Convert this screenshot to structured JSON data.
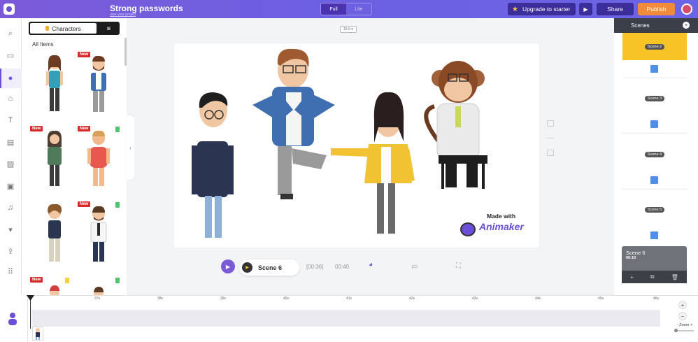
{
  "app": {
    "project_title": "Strong passwords",
    "project_subtitle": "user your project",
    "modes": [
      "Full",
      "Lite"
    ],
    "active_mode": "Full",
    "upgrade_label": "Upgrade to starter",
    "share_label": "Share",
    "publish_label": "Publish"
  },
  "left_rail": {
    "icons": [
      "search-icon",
      "folder-icon",
      "character-icon",
      "props-icon",
      "text-icon",
      "number-icon",
      "image-icon",
      "video-icon",
      "music-icon",
      "upload-bar-icon",
      "upload-icon",
      "apps-grid-icon"
    ],
    "active": "character-icon"
  },
  "library": {
    "tab_active": "Characters",
    "all_items_label": "All Items",
    "items": [
      {
        "name": "woman-teal",
        "badge": "",
        "flag": ""
      },
      {
        "name": "man-bearded-blue",
        "badge": "New",
        "flag": ""
      },
      {
        "name": "woman-camo",
        "badge": "New",
        "flag": ""
      },
      {
        "name": "man-red-tank",
        "badge": "New",
        "flag": "green"
      },
      {
        "name": "man-curly-navy",
        "badge": "",
        "flag": ""
      },
      {
        "name": "man-tie",
        "badge": "New",
        "flag": "green"
      },
      {
        "name": "partial-1",
        "badge": "New",
        "flag": "yellow"
      },
      {
        "name": "partial-2",
        "badge": "",
        "flag": "green"
      }
    ]
  },
  "canvas": {
    "ratio_label": "16:9 ▾",
    "watermark_top": "Made with",
    "watermark_brand": "Animaker"
  },
  "player": {
    "scene_label": "Scene 6",
    "current_time": "[00:36]",
    "total_time": "00:40"
  },
  "scenes_panel": {
    "title": "Scenes",
    "scenes": [
      "Scene 2",
      "Scene 3",
      "Scene 4",
      "Scene 5"
    ],
    "active_scene": {
      "name": "Scene 6",
      "duration": "00:10"
    }
  },
  "timeline": {
    "ticks": [
      "37s",
      "38s",
      "39s",
      "40s",
      "41s",
      "42s",
      "43s",
      "44s",
      "45s",
      "46s"
    ],
    "zoom_label": "- Zoom +"
  },
  "colors": {
    "brand": "#6b4fd6",
    "publish": "#f08a3c",
    "scene_active": "#f7c325",
    "scene_add": "#4f8fe9"
  }
}
